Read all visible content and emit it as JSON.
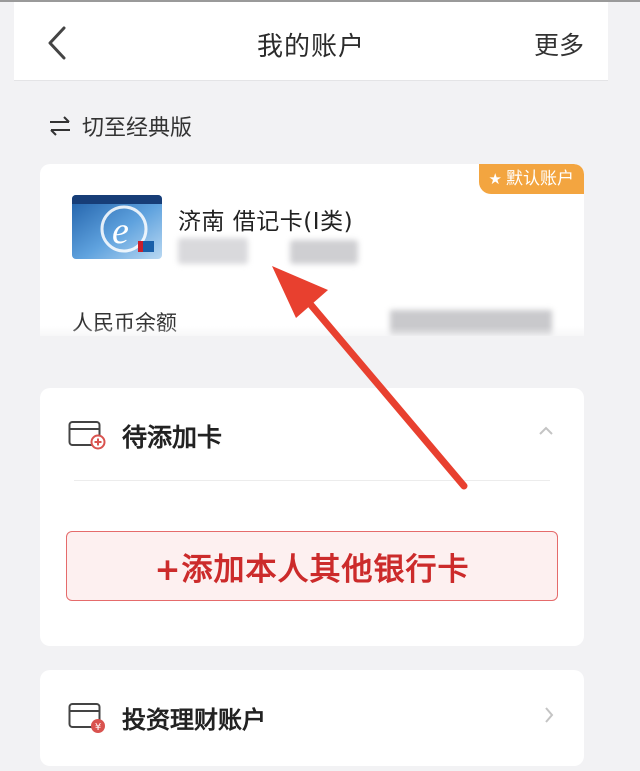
{
  "header": {
    "title": "我的账户",
    "more_label": "更多"
  },
  "switch_version": {
    "label": "切至经典版",
    "icon": "swap-arrows-icon"
  },
  "account_card": {
    "badge": "默认账户",
    "badge_icon": "star-icon",
    "card_name": "济南 借记卡(I类)",
    "balance_label": "人民币余额",
    "bank_logo": "bank-card-logo"
  },
  "pending_cards": {
    "title": "待添加卡",
    "add_button_label": "+添加本人其他银行卡"
  },
  "investment": {
    "title": "投资理财账户"
  },
  "colors": {
    "badge": "#f3a540",
    "accent_red": "#cc2b2b",
    "annotation_arrow": "#e8402f",
    "background": "#f2f2f4"
  }
}
